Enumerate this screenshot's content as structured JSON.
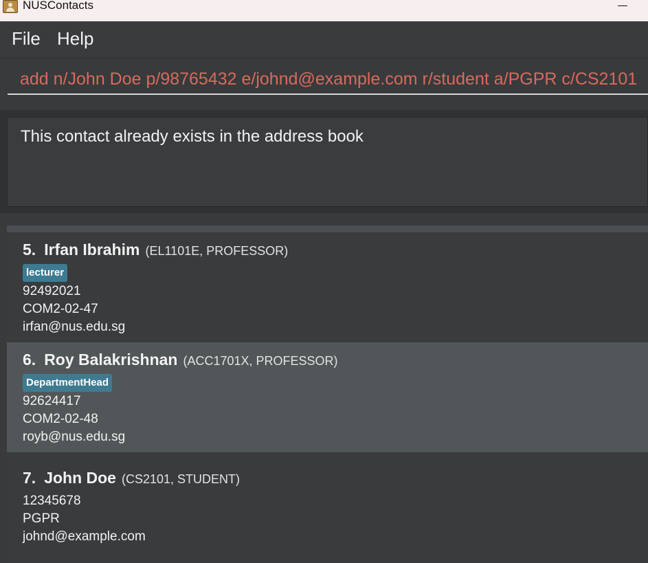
{
  "window": {
    "title": "NUSContacts",
    "minimize_glyph": "—"
  },
  "menu": {
    "file": "File",
    "help": "Help"
  },
  "command": {
    "value": "add n/John Doe p/98765432 e/johnd@example.com r/student a/PGPR c/CS2101",
    "error_color": "#d86a5c"
  },
  "result": {
    "message": "This contact already exists in the address book"
  },
  "contacts": [
    {
      "index": "5.",
      "name": "Irfan Ibrahim",
      "meta": "(EL1101E,  PROFESSOR)",
      "tag": "lecturer",
      "phone": "92492021",
      "address": "COM2-02-47",
      "email": "irfan@nus.edu.sg"
    },
    {
      "index": "6.",
      "name": "Roy Balakrishnan",
      "meta": "(ACC1701X,  PROFESSOR)",
      "tag": "DepartmentHead",
      "phone": "92624417",
      "address": "COM2-02-48",
      "email": "royb@nus.edu.sg"
    },
    {
      "index": "7.",
      "name": "John Doe",
      "meta": "(CS2101,  STUDENT)",
      "phone": "12345678",
      "address": "PGPR",
      "email": "johnd@example.com"
    }
  ],
  "colors": {
    "tag": "#3e7b91",
    "selected_card": "#515759",
    "background": "#383a3c"
  }
}
